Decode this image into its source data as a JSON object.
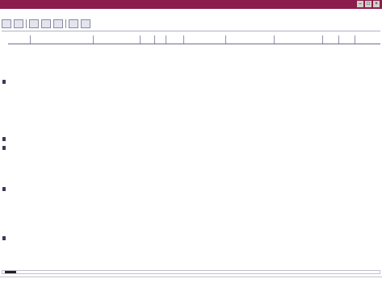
{
  "window": {
    "title": ""
  },
  "menu": [],
  "toolbar": {
    "buttons": []
  },
  "table": {
    "columns": [],
    "rows": []
  },
  "status": {
    "left": "",
    "middle": [],
    "right": ""
  }
}
